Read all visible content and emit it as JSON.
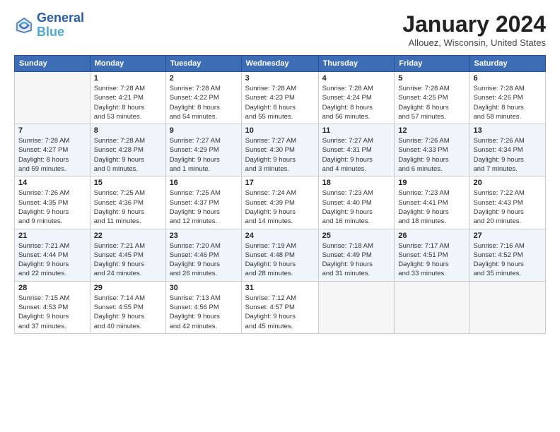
{
  "header": {
    "logo_line1": "General",
    "logo_line2": "Blue",
    "month": "January 2024",
    "location": "Allouez, Wisconsin, United States"
  },
  "days_of_week": [
    "Sunday",
    "Monday",
    "Tuesday",
    "Wednesday",
    "Thursday",
    "Friday",
    "Saturday"
  ],
  "weeks": [
    [
      {
        "day": "",
        "info": ""
      },
      {
        "day": "1",
        "info": "Sunrise: 7:28 AM\nSunset: 4:21 PM\nDaylight: 8 hours\nand 53 minutes."
      },
      {
        "day": "2",
        "info": "Sunrise: 7:28 AM\nSunset: 4:22 PM\nDaylight: 8 hours\nand 54 minutes."
      },
      {
        "day": "3",
        "info": "Sunrise: 7:28 AM\nSunset: 4:23 PM\nDaylight: 8 hours\nand 55 minutes."
      },
      {
        "day": "4",
        "info": "Sunrise: 7:28 AM\nSunset: 4:24 PM\nDaylight: 8 hours\nand 56 minutes."
      },
      {
        "day": "5",
        "info": "Sunrise: 7:28 AM\nSunset: 4:25 PM\nDaylight: 8 hours\nand 57 minutes."
      },
      {
        "day": "6",
        "info": "Sunrise: 7:28 AM\nSunset: 4:26 PM\nDaylight: 8 hours\nand 58 minutes."
      }
    ],
    [
      {
        "day": "7",
        "info": "Sunrise: 7:28 AM\nSunset: 4:27 PM\nDaylight: 8 hours\nand 59 minutes."
      },
      {
        "day": "8",
        "info": "Sunrise: 7:28 AM\nSunset: 4:28 PM\nDaylight: 9 hours\nand 0 minutes."
      },
      {
        "day": "9",
        "info": "Sunrise: 7:27 AM\nSunset: 4:29 PM\nDaylight: 9 hours\nand 1 minute."
      },
      {
        "day": "10",
        "info": "Sunrise: 7:27 AM\nSunset: 4:30 PM\nDaylight: 9 hours\nand 3 minutes."
      },
      {
        "day": "11",
        "info": "Sunrise: 7:27 AM\nSunset: 4:31 PM\nDaylight: 9 hours\nand 4 minutes."
      },
      {
        "day": "12",
        "info": "Sunrise: 7:26 AM\nSunset: 4:33 PM\nDaylight: 9 hours\nand 6 minutes."
      },
      {
        "day": "13",
        "info": "Sunrise: 7:26 AM\nSunset: 4:34 PM\nDaylight: 9 hours\nand 7 minutes."
      }
    ],
    [
      {
        "day": "14",
        "info": "Sunrise: 7:26 AM\nSunset: 4:35 PM\nDaylight: 9 hours\nand 9 minutes."
      },
      {
        "day": "15",
        "info": "Sunrise: 7:25 AM\nSunset: 4:36 PM\nDaylight: 9 hours\nand 11 minutes."
      },
      {
        "day": "16",
        "info": "Sunrise: 7:25 AM\nSunset: 4:37 PM\nDaylight: 9 hours\nand 12 minutes."
      },
      {
        "day": "17",
        "info": "Sunrise: 7:24 AM\nSunset: 4:39 PM\nDaylight: 9 hours\nand 14 minutes."
      },
      {
        "day": "18",
        "info": "Sunrise: 7:23 AM\nSunset: 4:40 PM\nDaylight: 9 hours\nand 16 minutes."
      },
      {
        "day": "19",
        "info": "Sunrise: 7:23 AM\nSunset: 4:41 PM\nDaylight: 9 hours\nand 18 minutes."
      },
      {
        "day": "20",
        "info": "Sunrise: 7:22 AM\nSunset: 4:43 PM\nDaylight: 9 hours\nand 20 minutes."
      }
    ],
    [
      {
        "day": "21",
        "info": "Sunrise: 7:21 AM\nSunset: 4:44 PM\nDaylight: 9 hours\nand 22 minutes."
      },
      {
        "day": "22",
        "info": "Sunrise: 7:21 AM\nSunset: 4:45 PM\nDaylight: 9 hours\nand 24 minutes."
      },
      {
        "day": "23",
        "info": "Sunrise: 7:20 AM\nSunset: 4:46 PM\nDaylight: 9 hours\nand 26 minutes."
      },
      {
        "day": "24",
        "info": "Sunrise: 7:19 AM\nSunset: 4:48 PM\nDaylight: 9 hours\nand 28 minutes."
      },
      {
        "day": "25",
        "info": "Sunrise: 7:18 AM\nSunset: 4:49 PM\nDaylight: 9 hours\nand 31 minutes."
      },
      {
        "day": "26",
        "info": "Sunrise: 7:17 AM\nSunset: 4:51 PM\nDaylight: 9 hours\nand 33 minutes."
      },
      {
        "day": "27",
        "info": "Sunrise: 7:16 AM\nSunset: 4:52 PM\nDaylight: 9 hours\nand 35 minutes."
      }
    ],
    [
      {
        "day": "28",
        "info": "Sunrise: 7:15 AM\nSunset: 4:53 PM\nDaylight: 9 hours\nand 37 minutes."
      },
      {
        "day": "29",
        "info": "Sunrise: 7:14 AM\nSunset: 4:55 PM\nDaylight: 9 hours\nand 40 minutes."
      },
      {
        "day": "30",
        "info": "Sunrise: 7:13 AM\nSunset: 4:56 PM\nDaylight: 9 hours\nand 42 minutes."
      },
      {
        "day": "31",
        "info": "Sunrise: 7:12 AM\nSunset: 4:57 PM\nDaylight: 9 hours\nand 45 minutes."
      },
      {
        "day": "",
        "info": ""
      },
      {
        "day": "",
        "info": ""
      },
      {
        "day": "",
        "info": ""
      }
    ]
  ]
}
